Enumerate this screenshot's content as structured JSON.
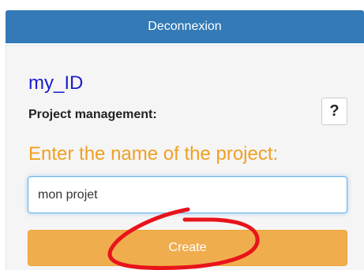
{
  "header": {
    "logout_label": "Deconnexion"
  },
  "panel": {
    "user_id": "my_ID",
    "project_management_label": "Project management:",
    "help_label": "?",
    "enter_name_label": "Enter the name of the project:",
    "project_name_value": "mon projet",
    "create_label": "Create"
  },
  "colors": {
    "primary": "#337ab7",
    "user_id": "#1c1ccf",
    "prompt": "#f0a023",
    "create_button": "#f0ad4e",
    "annotation": "#e8141b"
  },
  "annotation": {
    "shape": "red hand-drawn circle around create button"
  }
}
